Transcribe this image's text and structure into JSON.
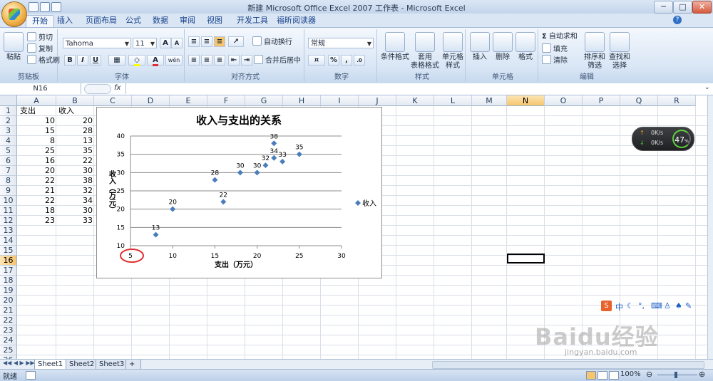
{
  "window": {
    "title": "新建 Microsoft Office Excel 2007 工作表 - Microsoft Excel",
    "controls": [
      "─",
      "□",
      "✕"
    ]
  },
  "ribbon_tabs": [
    "开始",
    "插入",
    "页面布局",
    "公式",
    "数据",
    "审阅",
    "视图",
    "开发工具",
    "福昕阅读器"
  ],
  "active_tab": "开始",
  "ribbon": {
    "clipboard": {
      "label": "剪贴板",
      "paste": "粘贴",
      "cut": "剪切",
      "copy": "复制",
      "format_painter": "格式刷"
    },
    "font": {
      "label": "字体",
      "font_name": "Tahoma",
      "font_size": "11",
      "grow": "A",
      "shrink": "A",
      "bold": "B",
      "italic": "I",
      "underline": "U",
      "color_a": "A",
      "wen": "wén"
    },
    "alignment": {
      "label": "对齐方式",
      "wrap": "自动换行",
      "merge": "合并后居中"
    },
    "number": {
      "label": "数字",
      "format": "常规",
      "percent": "%",
      "comma": ","
    },
    "styles": {
      "label": "样式",
      "conditional": "条件格式",
      "table": "套用\n表格格式",
      "cell_styles": "单元格\n样式"
    },
    "cells": {
      "label": "单元格",
      "insert": "插入",
      "delete": "删除",
      "format": "格式"
    },
    "editing": {
      "label": "编辑",
      "autosum": "自动求和",
      "fill": "填充",
      "clear": "清除",
      "sort": "排序和\n筛选",
      "find": "查找和\n选择"
    }
  },
  "formula_bar": {
    "name_box": "N16",
    "fx": "fx",
    "value": ""
  },
  "columns": [
    "A",
    "B",
    "C",
    "D",
    "E",
    "F",
    "G",
    "H",
    "I",
    "J",
    "K",
    "L",
    "M",
    "N",
    "O",
    "P",
    "Q",
    "R"
  ],
  "selected_column": "N",
  "rows": [
    "1",
    "2",
    "3",
    "4",
    "5",
    "6",
    "7",
    "8",
    "9",
    "10",
    "11",
    "12",
    "13",
    "14",
    "15",
    "16",
    "17",
    "18",
    "19",
    "20",
    "21",
    "22",
    "23",
    "24",
    "25",
    "26"
  ],
  "selected_row": "16",
  "cells": {
    "A1": "支出",
    "B1": "收入",
    "A2": "10",
    "B2": "20",
    "A3": "15",
    "B3": "28",
    "A4": "8",
    "B4": "13",
    "A5": "25",
    "B5": "35",
    "A6": "16",
    "B6": "22",
    "A7": "20",
    "B7": "30",
    "A8": "22",
    "B8": "38",
    "A9": "21",
    "B9": "32",
    "A10": "22",
    "B10": "34",
    "A11": "18",
    "B11": "30",
    "A12": "23",
    "B12": "33"
  },
  "chart_data": {
    "type": "scatter",
    "title": "收入与支出的关系",
    "xlabel": "支出（万元）",
    "ylabel": "收入（万元）",
    "xlim": [
      5,
      30
    ],
    "ylim": [
      10,
      40
    ],
    "xticks": [
      5,
      10,
      15,
      20,
      25,
      30
    ],
    "yticks": [
      10,
      15,
      20,
      25,
      30,
      35,
      40
    ],
    "grid": "horizontal",
    "legend": "right",
    "color": "#4a7ebb",
    "highlight_color": "#e03030",
    "series": [
      {
        "name": "收入",
        "points": [
          [
            10,
            20
          ],
          [
            15,
            28
          ],
          [
            8,
            13
          ],
          [
            25,
            35
          ],
          [
            16,
            22
          ],
          [
            20,
            30
          ],
          [
            22,
            38
          ],
          [
            21,
            32
          ],
          [
            22,
            34
          ],
          [
            18,
            30
          ],
          [
            23,
            33
          ]
        ]
      }
    ]
  },
  "sheets": [
    "Sheet1",
    "Sheet2",
    "Sheet3"
  ],
  "active_sheet": "Sheet1",
  "status": {
    "ready": "就绪",
    "zoom": "100%"
  },
  "net_widget": {
    "up": "0K/s",
    "down": "0K/s",
    "percent": "47"
  },
  "ime": {
    "lang": "中"
  },
  "watermark": {
    "brand": "Baidu经验",
    "url": "jingyan.baidu.com"
  }
}
